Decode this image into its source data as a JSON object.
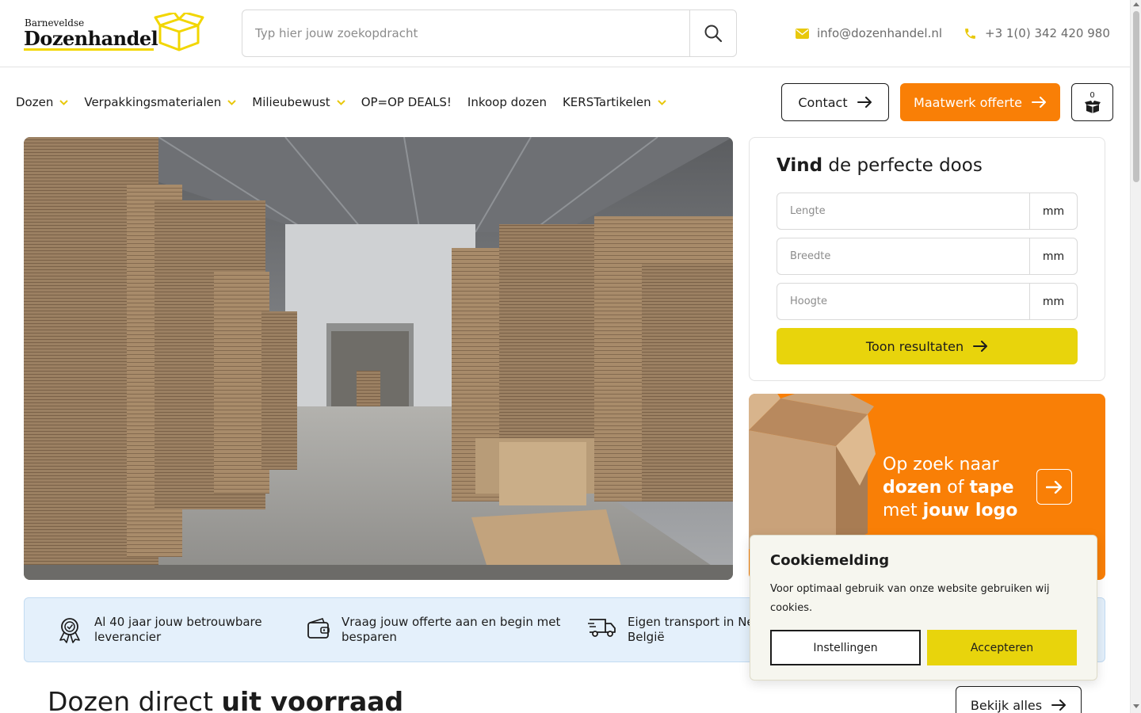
{
  "header": {
    "logo_small": "Barneveldse",
    "logo_big": "Dozenhandel",
    "search_placeholder": "Typ hier jouw zoekopdracht",
    "email": "info@dozenhandel.nl",
    "phone": "+3 1(0) 342 420 980"
  },
  "nav": {
    "items": [
      {
        "label": "Dozen",
        "dropdown": true
      },
      {
        "label": "Verpakkingsmaterialen",
        "dropdown": true
      },
      {
        "label": "Milieubewust",
        "dropdown": true
      },
      {
        "label": "OP=OP DEALS!",
        "dropdown": false
      },
      {
        "label": "Inkoop dozen",
        "dropdown": false
      },
      {
        "label": "KERSTartikelen",
        "dropdown": true
      }
    ],
    "contact_label": "Contact",
    "offerte_label": "Maatwerk offerte",
    "cart_count": "0"
  },
  "finder": {
    "title_bold": "Vind",
    "title_rest": " de perfecte doos",
    "fields": [
      {
        "placeholder": "Lengte",
        "unit": "mm"
      },
      {
        "placeholder": "Breedte",
        "unit": "mm"
      },
      {
        "placeholder": "Hoogte",
        "unit": "mm"
      }
    ],
    "button_label": "Toon resultaten"
  },
  "promo": {
    "line1": "Op zoek naar",
    "bold1": "dozen",
    "of": " of ",
    "bold2": "tape",
    "line3_pre": "met ",
    "bold3": "jouw logo"
  },
  "usp": {
    "items": [
      {
        "line1": "Al 40 jaar jouw betrouwbare",
        "line2": "leverancier",
        "icon": "award-icon"
      },
      {
        "line1": "Vraag jouw offerte aan en begin met",
        "line2": "besparen",
        "icon": "wallet-icon"
      },
      {
        "line1": "Eigen transport in Ne",
        "line2": "België",
        "icon": "truck-icon"
      }
    ]
  },
  "section": {
    "title_rest": "Dozen direct ",
    "title_bold": "uit voorraad",
    "view_all_label": "Bekijk alles"
  },
  "cookie": {
    "title": "Cookiemelding",
    "text": "Voor optimaal gebruik van onze website gebruiken wij cookies.",
    "settings_label": "Instellingen",
    "accept_label": "Accepteren"
  },
  "colors": {
    "brand_yellow": "#e8d40c",
    "brand_orange": "#f97f06",
    "usp_bg": "#e4f0fb"
  }
}
